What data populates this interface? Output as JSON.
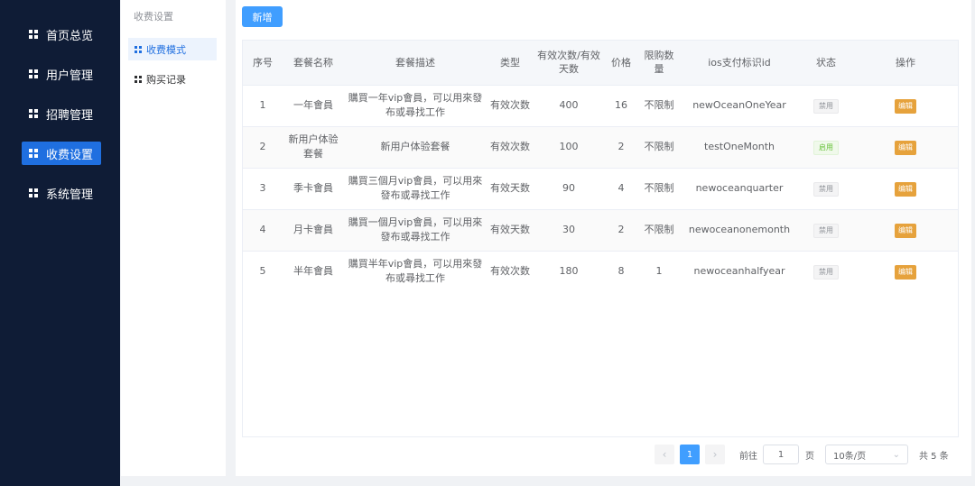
{
  "sidebar": {
    "items": [
      {
        "label": "首页总览"
      },
      {
        "label": "用户管理"
      },
      {
        "label": "招聘管理"
      },
      {
        "label": "收费设置"
      },
      {
        "label": "系统管理"
      }
    ]
  },
  "subnav": {
    "title": "收费设置",
    "items": [
      {
        "label": "收费模式"
      },
      {
        "label": "购买记录"
      }
    ]
  },
  "toolbar": {
    "add_label": "新增"
  },
  "table": {
    "headers": [
      "序号",
      "套餐名称",
      "套餐描述",
      "类型",
      "有效次数/有效天数",
      "价格",
      "限购数量",
      "ios支付标识id",
      "状态",
      "操作"
    ],
    "rows": [
      {
        "index": "1",
        "name": "一年會員",
        "desc": "購買一年vip會員，可以用來發布或尋找工作",
        "type": "有效次数",
        "count": "400",
        "price": "16",
        "limit": "不限制",
        "ios_id": "newOceanOneYear",
        "status": "禁用",
        "action": "编辑"
      },
      {
        "index": "2",
        "name": "新用户体验套餐",
        "desc": "新用户体验套餐",
        "type": "有效次数",
        "count": "100",
        "price": "2",
        "limit": "不限制",
        "ios_id": "testOneMonth",
        "status": "启用",
        "action": "编辑"
      },
      {
        "index": "3",
        "name": "季卡會員",
        "desc": "購買三個月vip會員，可以用來發布或尋找工作",
        "type": "有效天数",
        "count": "90",
        "price": "4",
        "limit": "不限制",
        "ios_id": "newoceanquarter",
        "status": "禁用",
        "action": "编辑"
      },
      {
        "index": "4",
        "name": "月卡會員",
        "desc": "購買一個月vip會員，可以用來發布或尋找工作",
        "type": "有效天数",
        "count": "30",
        "price": "2",
        "limit": "不限制",
        "ios_id": "newoceanonemonth",
        "status": "禁用",
        "action": "编辑"
      },
      {
        "index": "5",
        "name": "半年會員",
        "desc": "購買半年vip會員，可以用來發布或尋找工作",
        "type": "有效次数",
        "count": "180",
        "price": "8",
        "limit": "1",
        "ios_id": "newoceanhalfyear",
        "status": "禁用",
        "action": "编辑"
      }
    ]
  },
  "pagination": {
    "current_page": "1",
    "goto_prefix": "前往",
    "goto_value": "1",
    "goto_suffix": "页",
    "page_size": "10条/页",
    "total": "共 5 条"
  },
  "colors": {
    "primary": "#409eff",
    "sidebar_bg": "#0f1c36",
    "active_nav": "#1f6fe0",
    "edit": "#e6a23c",
    "enabled": "#67c23a"
  }
}
